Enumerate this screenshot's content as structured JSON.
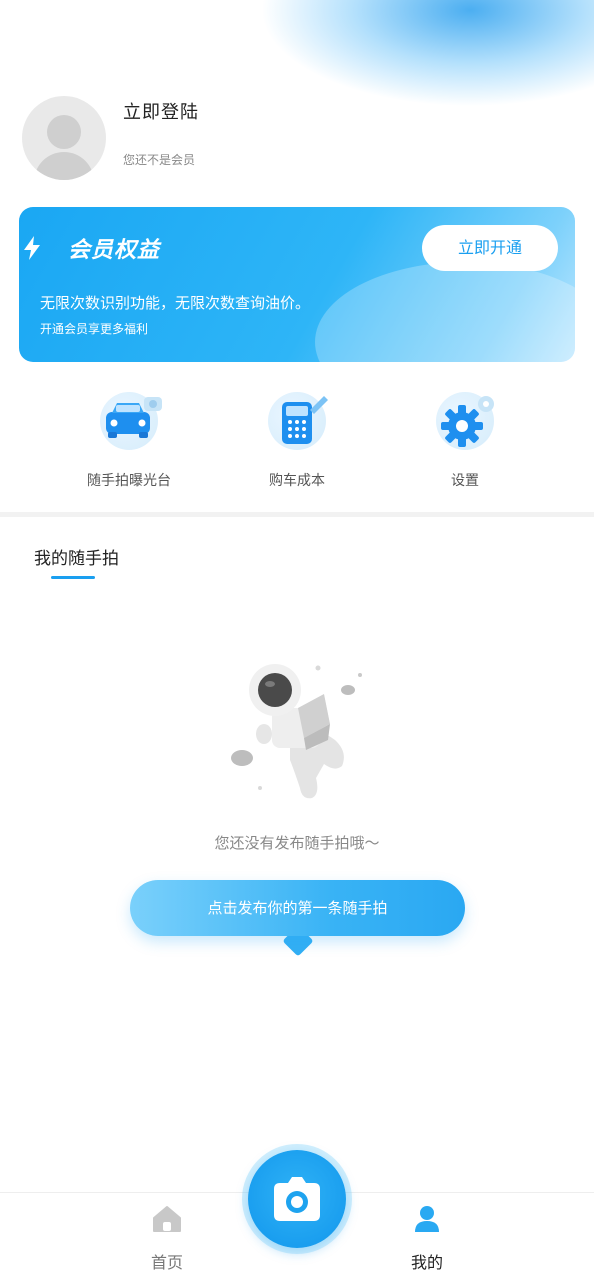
{
  "profile": {
    "login_label": "立即登陆",
    "member_status": "您还不是会员"
  },
  "member_card": {
    "title": "会员权益",
    "open_button": "立即开通",
    "description": "无限次数识别功能，无限次数查询油价。",
    "subtext": "开通会员享更多福利",
    "accent_color": "#1aa7f3"
  },
  "shortcuts": [
    {
      "label": "随手拍曝光台",
      "icon": "car-camera-icon"
    },
    {
      "label": "购车成本",
      "icon": "calculator-icon"
    },
    {
      "label": "设置",
      "icon": "gear-icon"
    }
  ],
  "section": {
    "title": "我的随手拍"
  },
  "empty_state": {
    "message": "您还没有发布随手拍哦～",
    "publish_button": "点击发布你的第一条随手拍"
  },
  "bottom_nav": {
    "home_label": "首页",
    "mine_label": "我的",
    "active": "我的"
  }
}
